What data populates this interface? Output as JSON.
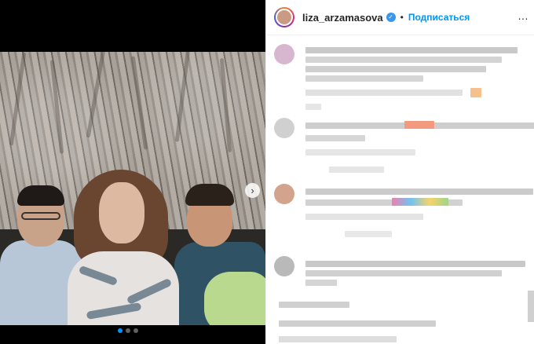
{
  "header": {
    "username": "liza_arzamasova",
    "separator": "•",
    "follow_label": "Подписаться"
  },
  "icons": {
    "verified": "verified-badge-icon",
    "next": "chevron-right-icon",
    "more": "more-options-icon"
  },
  "glyphs": {
    "verified": "✓",
    "next": "›",
    "more": "…"
  },
  "colors": {
    "accent": "#0095f6",
    "username": "#262626",
    "verified": "#3897f0"
  },
  "carousel": {
    "dots": 3,
    "active_index": 0
  }
}
